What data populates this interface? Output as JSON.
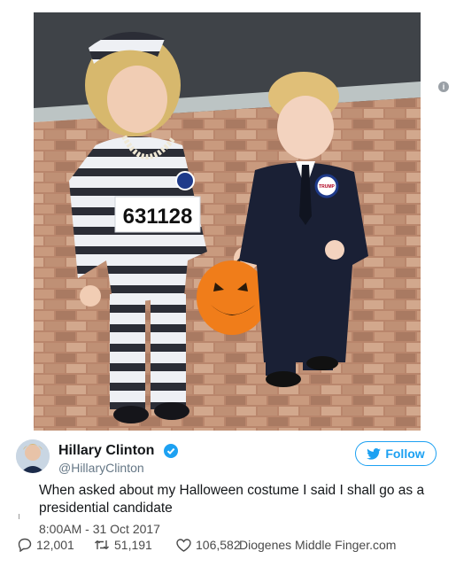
{
  "photo": {
    "badge_number": "631128",
    "button_text": "TRUMP"
  },
  "tweet": {
    "display_name": "Hillary Clinton",
    "handle": "@HillaryClinton",
    "follow_label": "Follow",
    "text": "When asked about my Halloween costume I said I shall go as a presidential candidate",
    "timestamp": "8:00AM - 31 Oct 2017",
    "replies": "12,001",
    "retweets": "51,191",
    "likes": "106,582"
  },
  "watermark": "Diogenes Middle Finger.com",
  "info_glyph": "i",
  "colors": {
    "twitter_blue": "#1da1f2",
    "pumpkin": "#f07d1a",
    "suit": "#1a2035"
  },
  "icons": [
    "info-icon",
    "verified-icon",
    "twitter-bird-icon",
    "reply-icon",
    "retweet-icon",
    "like-icon"
  ]
}
